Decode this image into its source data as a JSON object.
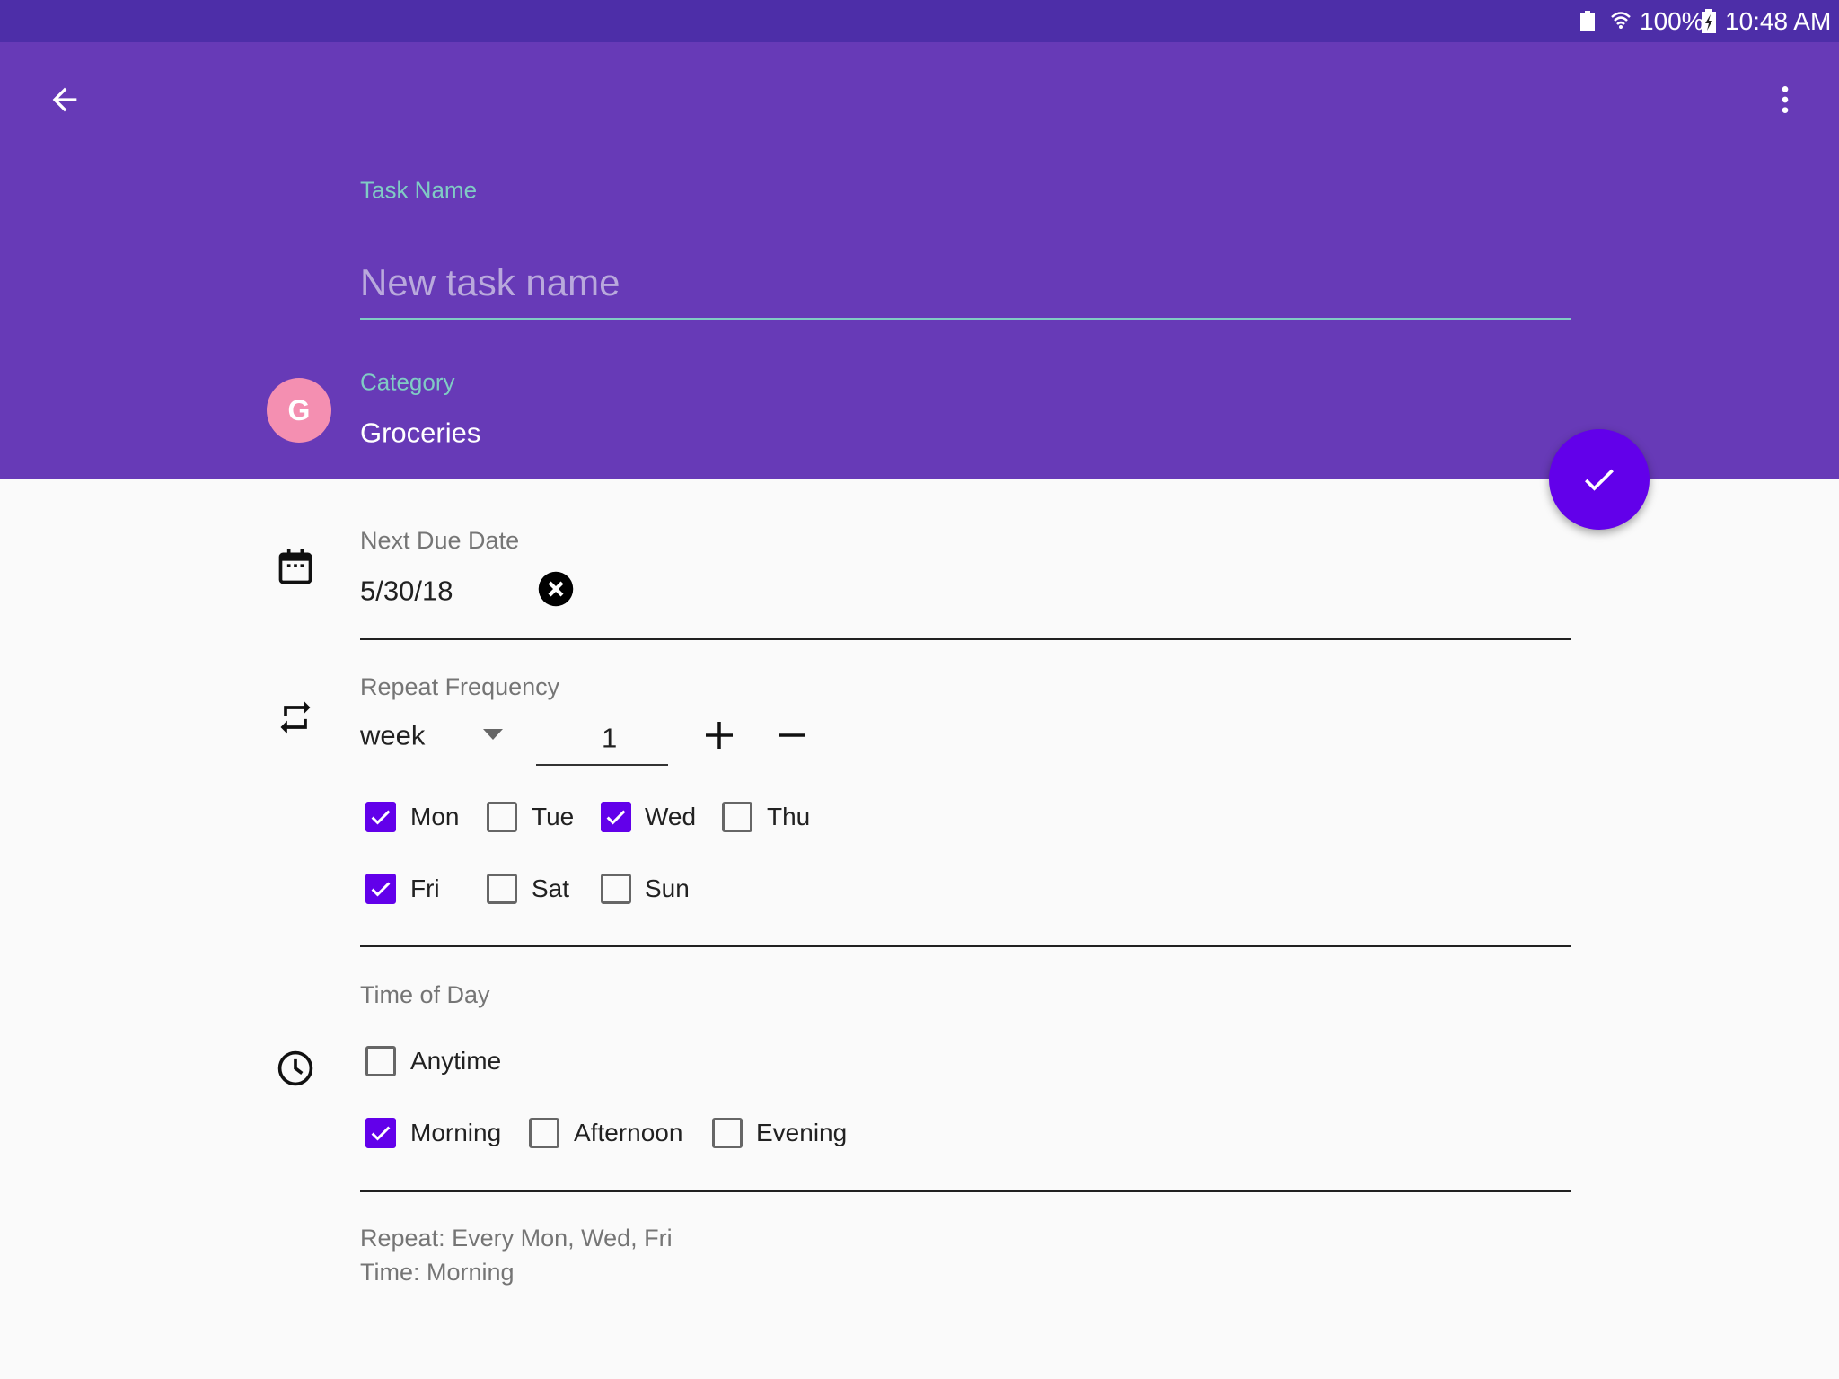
{
  "status_bar": {
    "battery": "100%",
    "time": "10:48 AM"
  },
  "colors": {
    "status": "#4d2ea8",
    "appbar": "#673ab7",
    "accent": "#6200ea",
    "category": "#f48fb1",
    "label": "#80cbc4"
  },
  "task_name": {
    "label": "Task Name",
    "placeholder": "New task name",
    "value": ""
  },
  "category": {
    "label": "Category",
    "value": "Groceries",
    "avatar": "G"
  },
  "due_date": {
    "label": "Next Due Date",
    "value": "5/30/18"
  },
  "repeat": {
    "label": "Repeat Frequency",
    "unit": "week",
    "count": "1",
    "days": [
      {
        "label": "Mon",
        "checked": true
      },
      {
        "label": "Tue",
        "checked": false
      },
      {
        "label": "Wed",
        "checked": true
      },
      {
        "label": "Thu",
        "checked": false
      },
      {
        "label": "Fri",
        "checked": true
      },
      {
        "label": "Sat",
        "checked": false
      },
      {
        "label": "Sun",
        "checked": false
      }
    ]
  },
  "time_of_day": {
    "label": "Time of Day",
    "options": [
      {
        "label": "Anytime",
        "checked": false
      },
      {
        "label": "Morning",
        "checked": true
      },
      {
        "label": "Afternoon",
        "checked": false
      },
      {
        "label": "Evening",
        "checked": false
      }
    ]
  },
  "summary": {
    "repeat": "Repeat: Every Mon, Wed, Fri",
    "time": "Time: Morning"
  }
}
